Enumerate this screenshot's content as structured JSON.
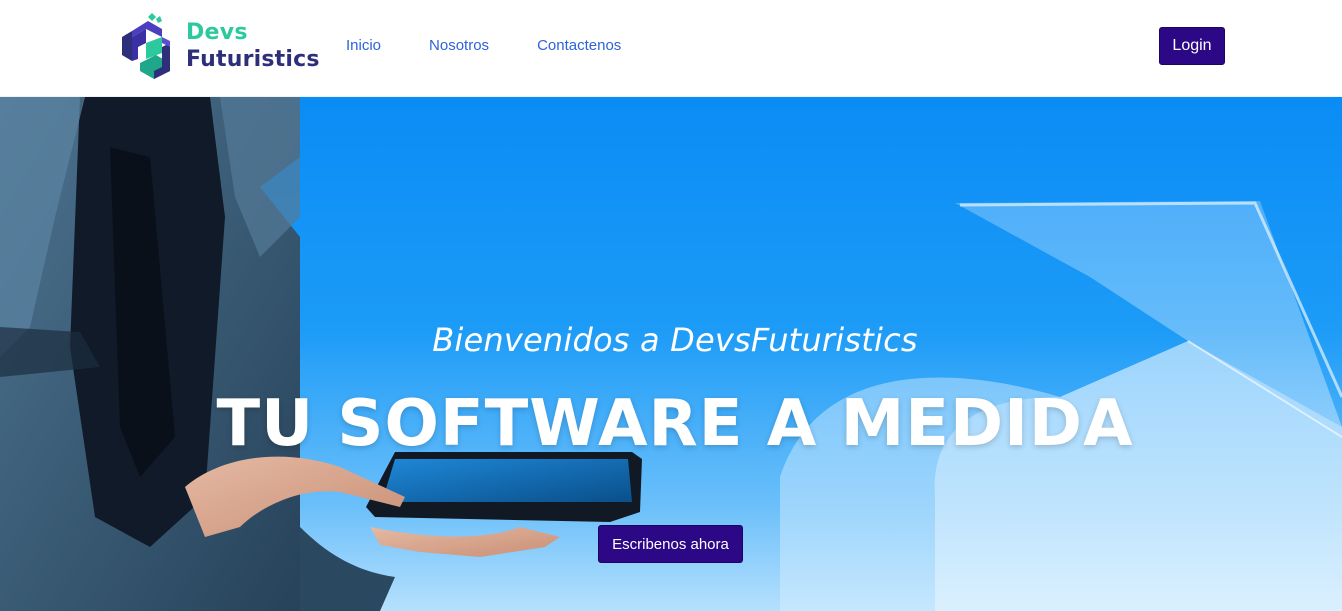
{
  "brand": {
    "line1": "Devs",
    "line2": "Futuristics",
    "icon": "devs-futuristics-logo-icon",
    "colors": {
      "primary": "#2cc99e",
      "secondary": "#2e2f7a",
      "mark": "#3a2aa8"
    }
  },
  "nav": {
    "items": [
      {
        "label": "Inicio"
      },
      {
        "label": "Nosotros"
      },
      {
        "label": "Contactenos"
      }
    ],
    "login_label": "Login"
  },
  "hero": {
    "subtitle": "Bienvenidos a DevsFuturistics",
    "title": "TU SOFTWARE A MEDIDA",
    "cta_label": "Escribenos ahora",
    "image": "businessman-holding-tablet-photo",
    "background_color": "#0a8cf5"
  },
  "colors": {
    "button": "#2c0886",
    "link": "#2e63d8"
  }
}
